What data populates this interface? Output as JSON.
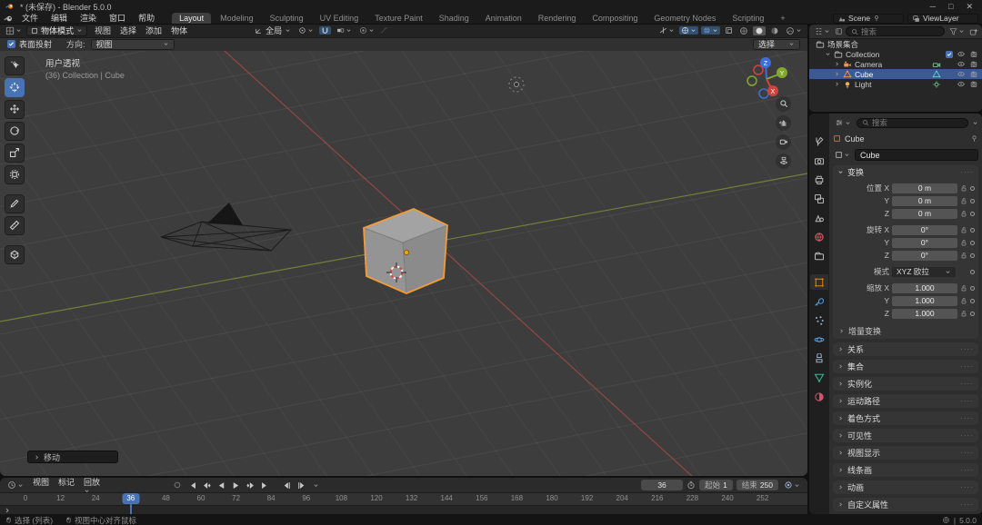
{
  "window": {
    "title": "* (未保存) - Blender 5.0.0",
    "minimize": "─",
    "maximize": "□",
    "close": "✕"
  },
  "topbar": {
    "menus": [
      "文件",
      "编辑",
      "渲染",
      "窗口",
      "帮助"
    ],
    "workspaces": [
      "Layout",
      "Modeling",
      "Sculpting",
      "UV Editing",
      "Texture Paint",
      "Shading",
      "Animation",
      "Rendering",
      "Compositing",
      "Geometry Nodes",
      "Scripting",
      "+"
    ],
    "active_workspace": "Layout",
    "scene": "Scene",
    "view_layer": "ViewLayer"
  },
  "viewport": {
    "mode": "物体模式",
    "menus": [
      "视图",
      "选择",
      "添加",
      "物体"
    ],
    "orientation": "全局",
    "tool_settings": {
      "surface_project": "表面投射",
      "direction_label": "方向:",
      "direction_value": "视图",
      "select_dropdown": "选择"
    },
    "overlay_line1": "用户透视",
    "overlay_line2": "(36) Collection | Cube",
    "operator_box": "移动",
    "tools": [
      "box-select",
      "cursor",
      "move",
      "rotate",
      "scale",
      "transform",
      "annotate",
      "measure",
      "add-cube"
    ],
    "active_tool": "cursor",
    "gizmo_axes": [
      "X",
      "Y",
      "Z"
    ]
  },
  "timeline": {
    "menus": [
      "视图",
      "标记",
      "回放"
    ],
    "current_frame": "36",
    "start_label": "起始",
    "start_value": "1",
    "end_label": "结束",
    "end_value": "250",
    "ticks": [
      0,
      12,
      24,
      36,
      48,
      60,
      72,
      84,
      96,
      108,
      120,
      132,
      144,
      156,
      168,
      180,
      192,
      204,
      216,
      228,
      240,
      252
    ],
    "playhead_frame": 36
  },
  "outliner": {
    "search_placeholder": "搜索",
    "rows": [
      {
        "label": "场景集合",
        "icon": "scene-collection",
        "level": 0,
        "expand": "",
        "selected": false,
        "checkbox": false,
        "data_icon": "",
        "eye": false,
        "render": false
      },
      {
        "label": "Collection",
        "icon": "collection",
        "level": 1,
        "expand": "down",
        "selected": false,
        "checkbox": true,
        "data_icon": "",
        "eye": true,
        "render": true
      },
      {
        "label": "Camera",
        "icon": "camera-object",
        "level": 2,
        "expand": "right",
        "selected": false,
        "checkbox": false,
        "data_icon": "camera-data",
        "eye": true,
        "render": true
      },
      {
        "label": "Cube",
        "icon": "mesh-object",
        "level": 2,
        "expand": "right",
        "selected": true,
        "checkbox": false,
        "data_icon": "mesh-data",
        "eye": true,
        "render": true
      },
      {
        "label": "Light",
        "icon": "light-object",
        "level": 2,
        "expand": "right",
        "selected": false,
        "checkbox": false,
        "data_icon": "light-data",
        "eye": true,
        "render": true
      }
    ]
  },
  "properties": {
    "search_placeholder": "搜索",
    "breadcrumb": "Cube",
    "name_value": "Cube",
    "tabs": [
      "tool",
      "render",
      "output",
      "view-layer",
      "scene",
      "world",
      "collection",
      "object",
      "modifiers",
      "particles",
      "physics",
      "constraints",
      "data",
      "material"
    ],
    "active_tab": "object",
    "transform": {
      "title": "变换",
      "rows": [
        {
          "label": "位置 X",
          "value": "0 m",
          "type": "field"
        },
        {
          "label": "Y",
          "value": "0 m",
          "type": "field"
        },
        {
          "label": "Z",
          "value": "0 m",
          "type": "field"
        },
        {
          "label": "旋转 X",
          "value": "0°",
          "type": "field",
          "gap": true
        },
        {
          "label": "Y",
          "value": "0°",
          "type": "field"
        },
        {
          "label": "Z",
          "value": "0°",
          "type": "field"
        },
        {
          "label": "模式",
          "value": "XYZ 欧拉",
          "type": "dropdown",
          "gap": true
        },
        {
          "label": "缩放 X",
          "value": "1.000",
          "type": "field",
          "gap": true
        },
        {
          "label": "Y",
          "value": "1.000",
          "type": "field"
        },
        {
          "label": "Z",
          "value": "1.000",
          "type": "field"
        }
      ],
      "delta_label": "增量变换"
    },
    "panels": [
      "关系",
      "集合",
      "实例化",
      "运动路径",
      "着色方式",
      "可见性",
      "视图显示",
      "线条画",
      "动画",
      "自定义属性"
    ]
  },
  "statusbar": {
    "hints": [
      "选择 (列表)",
      "视图中心对齐鼠标"
    ],
    "version": "5.0.0"
  },
  "colors": {
    "accent": "#4772b3",
    "selection_orange": "#f39b39",
    "axis_x": "#a84a44",
    "axis_y": "#7a8c3a"
  }
}
